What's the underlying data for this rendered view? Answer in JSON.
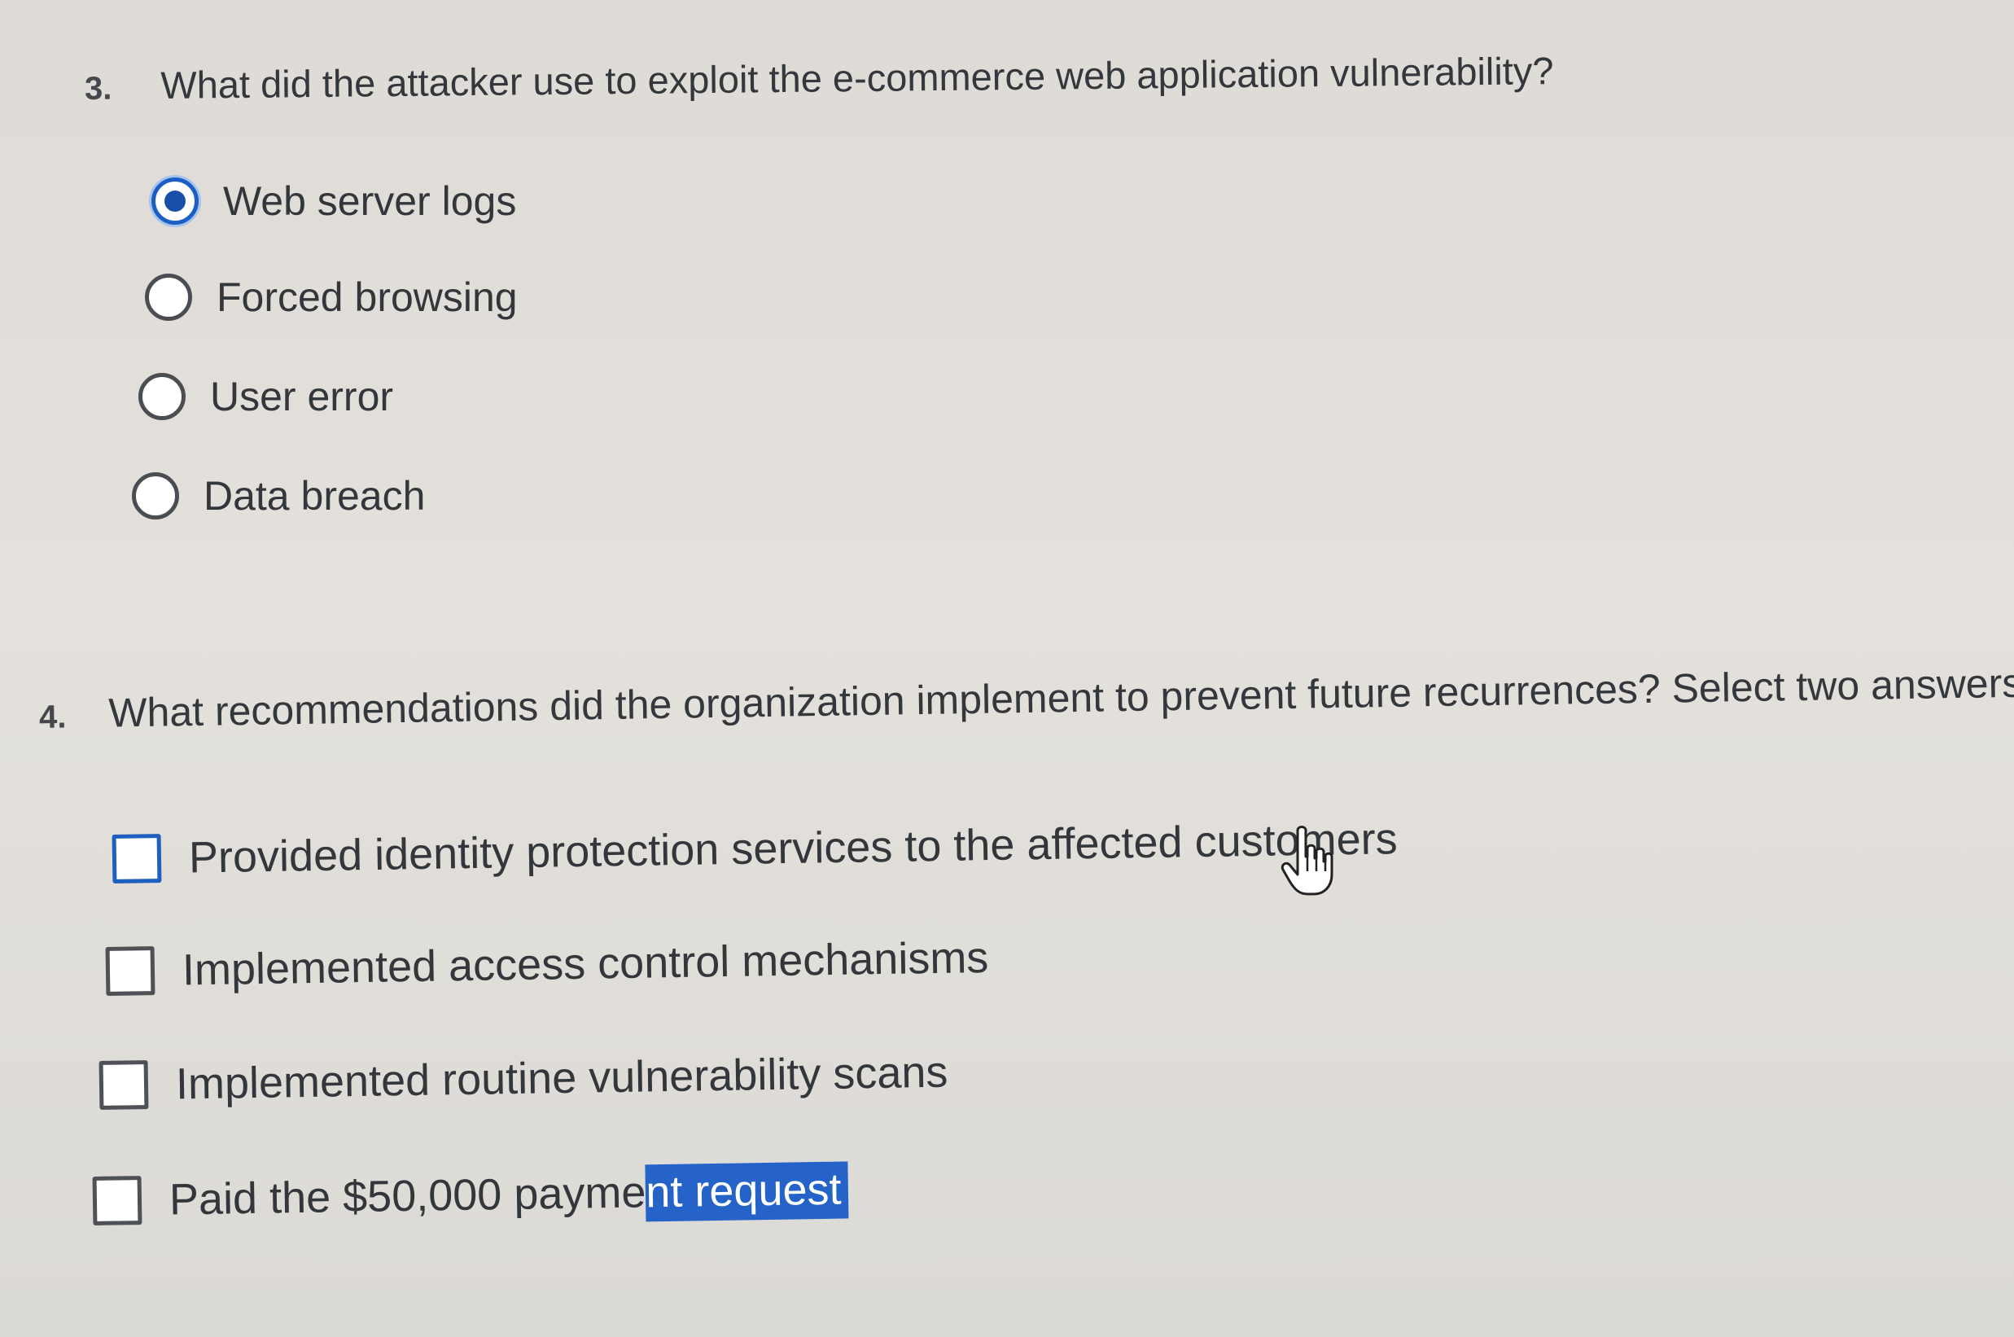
{
  "questions": {
    "q3": {
      "number": "3.",
      "text": "What did the attacker use to exploit the e-commerce web application vulnerability?",
      "options": [
        {
          "label": "Web server logs",
          "selected": true
        },
        {
          "label": "Forced browsing",
          "selected": false
        },
        {
          "label": "User error",
          "selected": false
        },
        {
          "label": "Data breach",
          "selected": false
        }
      ]
    },
    "q4": {
      "number": "4.",
      "text": "What recommendations did the organization implement to prevent future recurrences? Select two answers",
      "options": [
        {
          "label": "Provided identity protection services to the affected customers",
          "checked": false
        },
        {
          "label": "Implemented access control mechanisms",
          "checked": false
        },
        {
          "label": "Implemented routine vulnerability scans",
          "checked": false
        },
        {
          "label_plain": "Paid the $50,000 payme",
          "label_highlight": "nt request",
          "checked": false
        }
      ]
    }
  },
  "colors": {
    "accent": "#1b5fc4",
    "selection_highlight": "#2563c9",
    "text": "#34373b"
  },
  "icons": {
    "cursor": "hand-pointer-icon",
    "radio_selected": "radio-selected-icon",
    "radio_unselected": "radio-unselected-icon",
    "checkbox": "checkbox-icon"
  }
}
